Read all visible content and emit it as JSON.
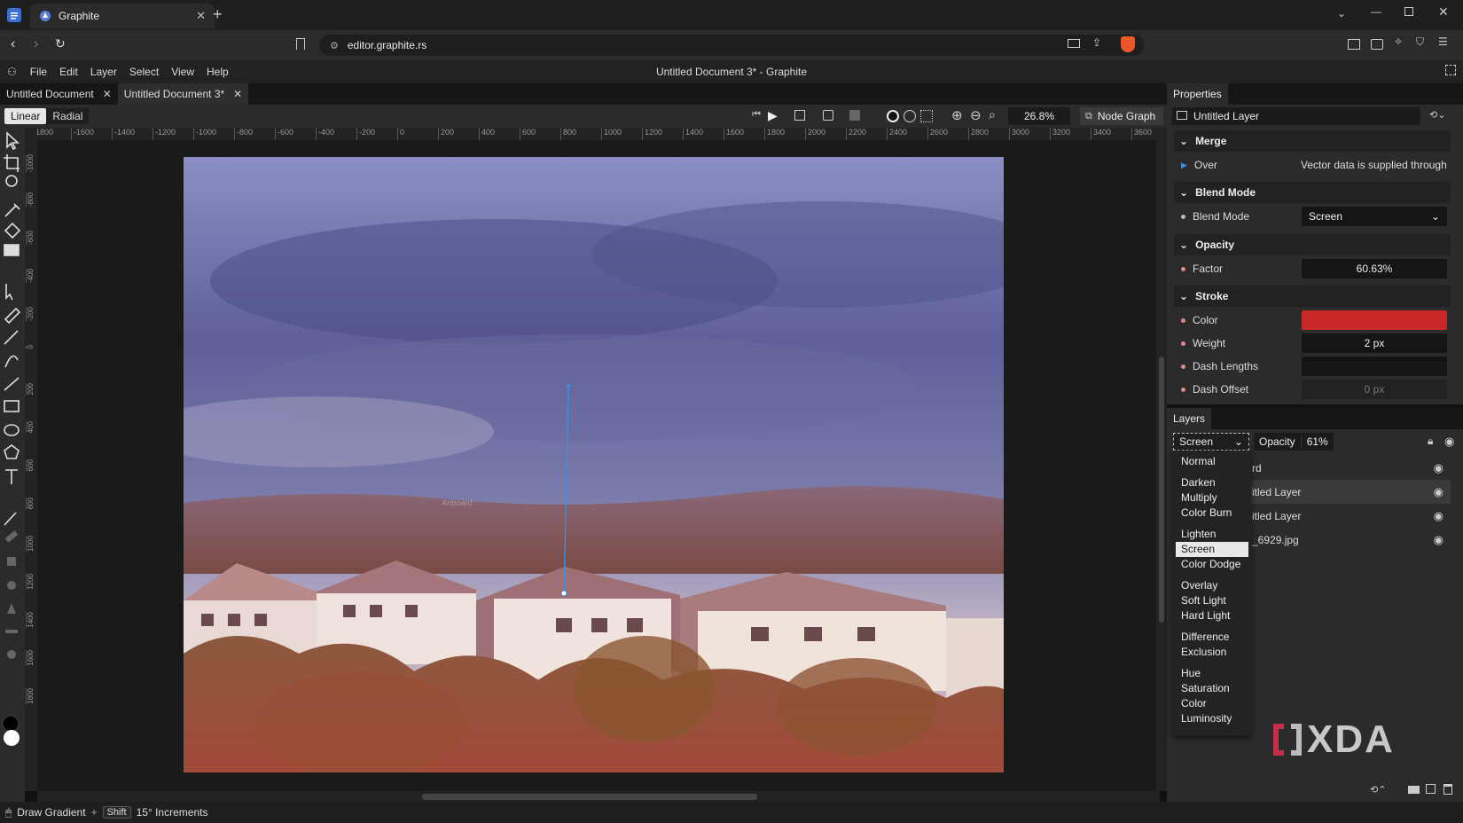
{
  "browser": {
    "tab_title": "Graphite",
    "url": "editor.graphite.rs"
  },
  "app": {
    "window_title": "Untitled Document 3* - Graphite",
    "menu": [
      "File",
      "Edit",
      "Layer",
      "Select",
      "View",
      "Help"
    ]
  },
  "doc_tabs": [
    {
      "label": "Untitled Document",
      "active": false
    },
    {
      "label": "Untitled Document 3*",
      "active": true
    }
  ],
  "tool_options": {
    "gradient_types": [
      "Linear",
      "Radial"
    ],
    "selected_type": "Linear",
    "zoom": "26.8%",
    "node_graph_label": "Node Graph"
  },
  "ruler": {
    "h_labels": [
      "-1800",
      "-1600",
      "-1400",
      "-1200",
      "-1000",
      "-800",
      "-600",
      "-400",
      "-200",
      "0",
      "200",
      "400",
      "600",
      "800",
      "1000",
      "1200",
      "1400",
      "1600",
      "1800",
      "2000",
      "2200",
      "2400",
      "2600",
      "2800",
      "3000",
      "3200",
      "3400",
      "3600"
    ],
    "v_labels": [
      "-1000",
      "-800",
      "-600",
      "-400",
      "-200",
      "0",
      "200",
      "400",
      "600",
      "800",
      "1000",
      "1200",
      "1400",
      "1600",
      "1800"
    ]
  },
  "canvas": {
    "artboard_label": "Artboard"
  },
  "properties": {
    "panel_title": "Properties",
    "layer_name": "Untitled Layer",
    "merge": {
      "title": "Merge",
      "over_label": "Over",
      "over_value": "Vector data is supplied through th"
    },
    "blend": {
      "title": "Blend Mode",
      "label": "Blend Mode",
      "value": "Screen"
    },
    "opacity": {
      "title": "Opacity",
      "label": "Factor",
      "value": "60.63%"
    },
    "stroke": {
      "title": "Stroke",
      "color_label": "Color",
      "color_value": "#c8282a",
      "weight_label": "Weight",
      "weight_value": "2 px",
      "dash_lengths_label": "Dash Lengths",
      "dash_offset_label": "Dash Offset",
      "dash_offset_value": "0 px"
    }
  },
  "layers": {
    "panel_title": "Layers",
    "blend_value": "Screen",
    "opacity_label": "Opacity",
    "opacity_value": "61%",
    "rows": [
      {
        "name": "rd",
        "selected": false
      },
      {
        "name": "itled Layer",
        "selected": true
      },
      {
        "name": "itled Layer",
        "selected": false
      },
      {
        "name": "_6929.jpg",
        "selected": false
      }
    ],
    "blend_options": [
      [
        "Normal"
      ],
      [
        "Darken",
        "Multiply",
        "Color Burn"
      ],
      [
        "Lighten",
        "Screen",
        "Color Dodge"
      ],
      [
        "Overlay",
        "Soft Light",
        "Hard Light"
      ],
      [
        "Difference",
        "Exclusion"
      ],
      [
        "Hue",
        "Saturation",
        "Color",
        "Luminosity"
      ]
    ],
    "blend_selected": "Screen"
  },
  "watermark": "XDA",
  "status": {
    "action": "Draw Gradient",
    "plus": "+",
    "key": "Shift",
    "hint": "15° Increments"
  },
  "colors": {
    "accent_blue": "#3a8fe0",
    "stroke_red": "#c8282a"
  }
}
